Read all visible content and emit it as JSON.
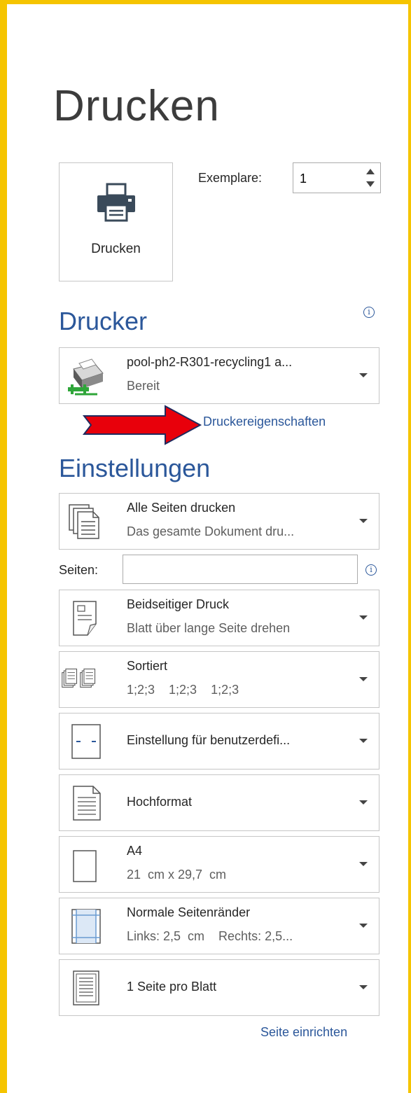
{
  "page": {
    "title": "Drucken"
  },
  "print_button": {
    "label": "Drucken"
  },
  "copies": {
    "label": "Exemplare:",
    "value": "1"
  },
  "printer_section": {
    "heading": "Drucker",
    "printer": {
      "name": "pool-ph2-R301-recycling1 a...",
      "status": "Bereit"
    },
    "properties_link": "Druckereigenschaften"
  },
  "settings_section": {
    "heading": "Einstellungen",
    "pages_label": "Seiten:",
    "pages_value": "",
    "dropdowns": [
      {
        "line1": "Alle Seiten drucken",
        "line2": "Das gesamte Dokument dru..."
      },
      {
        "line1": "Beidseitiger Druck",
        "line2": "Blatt über lange Seite drehen"
      },
      {
        "line1": "Sortiert",
        "line2": "1;2;3    1;2;3    1;2;3"
      },
      {
        "line1": "Einstellung für benutzerdefi..."
      },
      {
        "line1": "Hochformat"
      },
      {
        "line1": "A4",
        "line2": "21  cm x 29,7  cm"
      },
      {
        "line1": "Normale Seitenränder",
        "line2": "Links: 2,5  cm    Rechts: 2,5..."
      },
      {
        "line1": "1 Seite pro Blatt"
      }
    ],
    "page_setup_link": "Seite einrichten"
  },
  "colors": {
    "accent": "#2b579a",
    "frame": "#f5c400",
    "arrow": "#e8000b"
  }
}
